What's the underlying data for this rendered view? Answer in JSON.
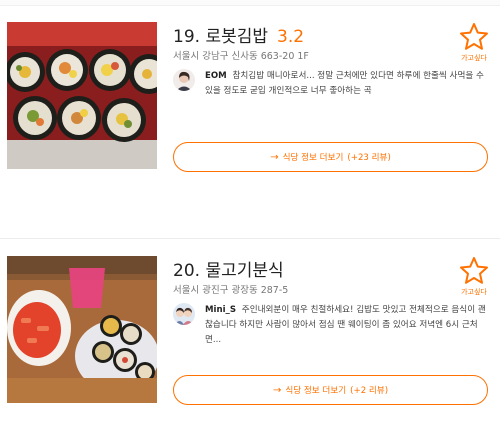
{
  "restaurants": [
    {
      "rank_title": "19. 로봇김밥",
      "rating": "3.2",
      "address": "서울시 강남구 신사동 663-20 1F",
      "review": {
        "user": "EOM",
        "text": "참치김밥 매니아로서... 정말 근처에만 있다면 하루에 한줄씩 사먹을 수 있을 정도로 굳입 개인적으로 너무 좋아하는 곡"
      },
      "fav_label": "가고싶다",
      "more_button": {
        "arrow": "→",
        "label": "식당 정보 더보기",
        "count": "(+23 리뷰)"
      }
    },
    {
      "rank_title": "20. 물고기분식",
      "rating": "",
      "address": "서울시 광진구 광장동 287-5",
      "review": {
        "user": "Mini_S",
        "text": "주인내외분이 매우 친절하세요! 김밥도 맛있고 전체적으로 음식이 괜찮습니다 하지만 사람이 많아서 점심 땐 웨이팅이 좀 있어요 저녁엔 6시 근처면..."
      },
      "fav_label": "가고싶다",
      "more_button": {
        "arrow": "→",
        "label": "식당 정보 더보기",
        "count": "(+2 리뷰)"
      }
    }
  ],
  "colors": {
    "accent": "#ff7100",
    "title": "#222222",
    "meta": "#777777"
  },
  "icons": {
    "favorite": "star-outline-icon",
    "more": "arrow-right-icon"
  }
}
